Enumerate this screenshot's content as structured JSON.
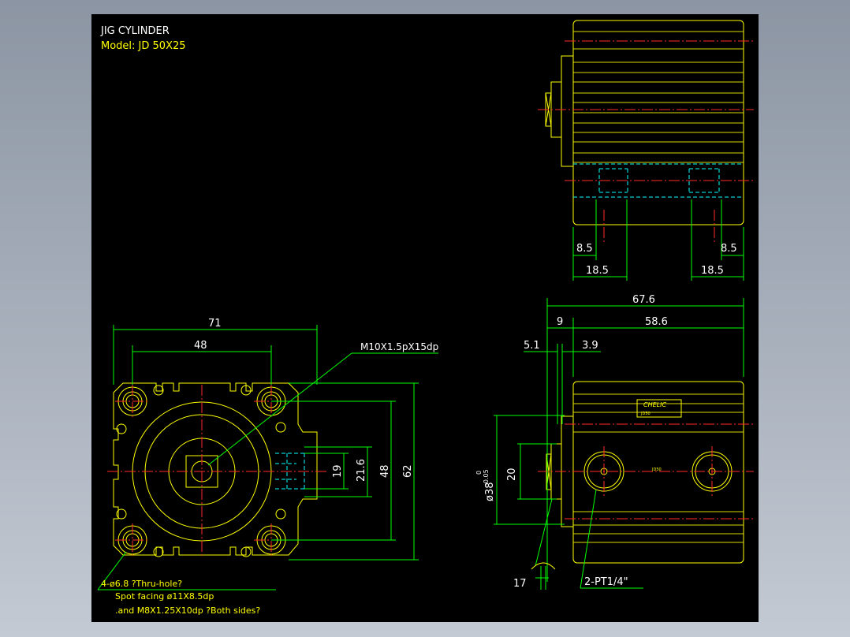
{
  "title_block": {
    "title": "JIG CYLINDER",
    "model": "Model:  JD 50X25"
  },
  "dimensions": {
    "top_left_85": "8.5",
    "top_right_85": "8.5",
    "top_left_185": "18.5",
    "top_right_185": "18.5",
    "overall_length": "67.6",
    "rod_9": "9",
    "body_586": "58.6",
    "dim_51": "5.1",
    "dim_39": "3.9",
    "width_71": "71",
    "width_48": "48",
    "height_19": "19",
    "height_216": "21.6",
    "height_48": "48",
    "height_62": "62",
    "dia_38": "ø38",
    "tol_upper": "0",
    "tol_lower": "-0.05",
    "dim_20": "20",
    "dim_17": "17"
  },
  "callouts": {
    "thread": "M10X1.5pX15dp",
    "port": "2-PT1/4\"",
    "hole_line1": "4-ø6.8    ?Thru-hole?",
    "hole_line2": "Spot facing  ø11X8.5dp",
    "hole_line3": ".and M8X1.25X10dp ?Both sides?"
  },
  "nameplate": {
    "brand": "CHELIC",
    "code": "JD50",
    "small_label": "JD50"
  },
  "colors": {
    "background": "#000000",
    "outline": "#ffff00",
    "dimension": "#00ff00",
    "centerline": "#ff2a2a",
    "hidden": "#00ffff",
    "text": "#ffffff"
  }
}
